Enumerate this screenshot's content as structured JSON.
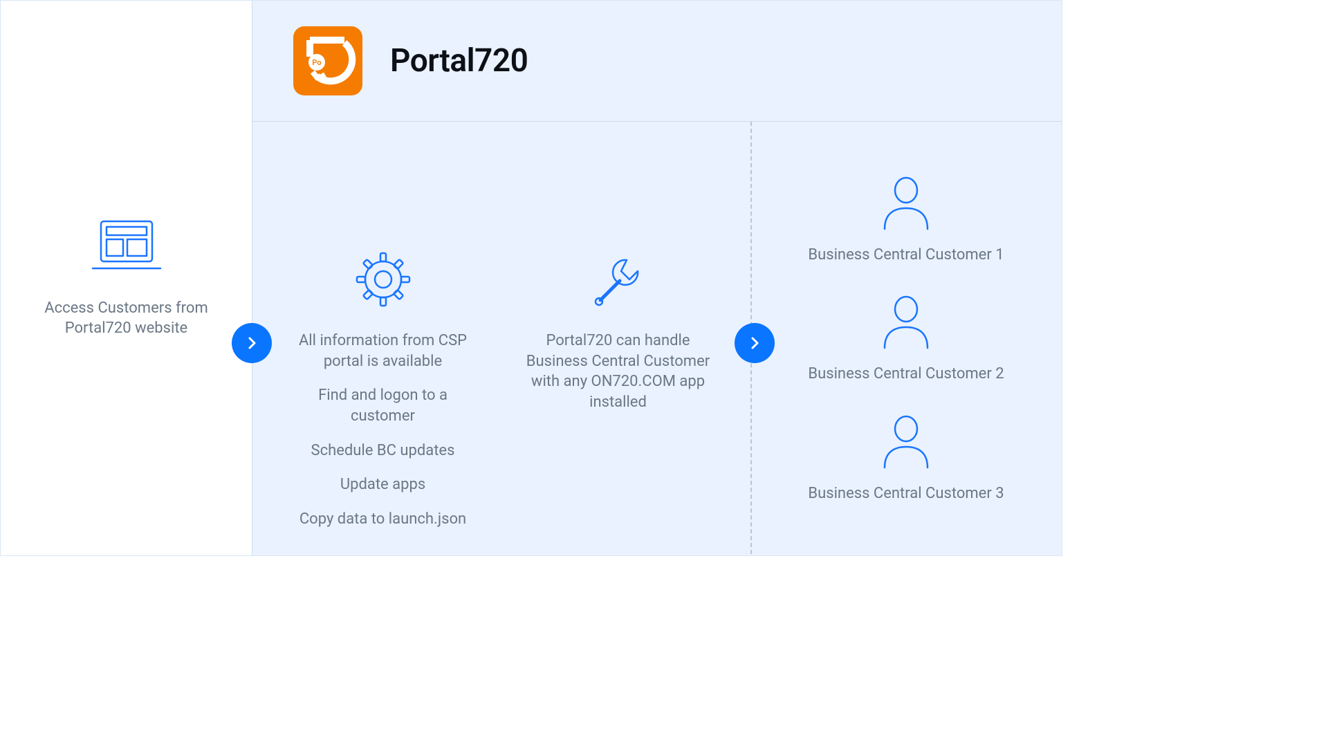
{
  "brand": {
    "title": "Portal720",
    "logo_badge_text": "Po"
  },
  "left": {
    "caption": "Access Customers from Portal720 website"
  },
  "center": {
    "col1": {
      "lines": [
        "All information from CSP portal is available",
        "Find and logon to a customer",
        "Schedule BC updates",
        "Update apps",
        "Copy data to launch.json"
      ]
    },
    "col2": {
      "text": "Portal720 can handle Business Central Customer with any ON720.COM app installed"
    }
  },
  "customers": [
    {
      "label": "Business Central Customer 1"
    },
    {
      "label": "Business Central Customer 2"
    },
    {
      "label": "Business Central Customer 3"
    }
  ]
}
